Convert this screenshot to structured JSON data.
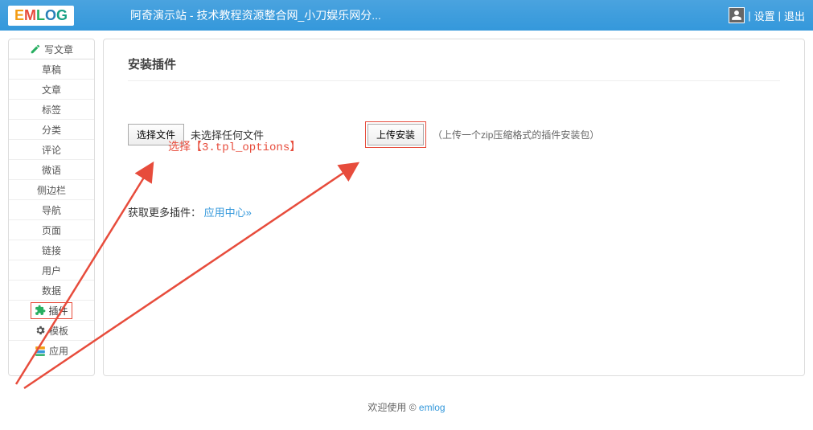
{
  "topbar": {
    "site_title": "阿奇演示站 - 技术教程资源整合网_小刀娱乐网分...",
    "settings": "设置",
    "logout": "退出"
  },
  "logo": {
    "E": "E",
    "M": "M",
    "L": "L",
    "O": "O",
    "G": "G"
  },
  "sidebar": {
    "items": [
      {
        "label": "写文章",
        "icon": "pencil"
      },
      {
        "label": "草稿"
      },
      {
        "label": "文章"
      },
      {
        "label": "标签"
      },
      {
        "label": "分类"
      },
      {
        "label": "评论"
      },
      {
        "label": "微语"
      },
      {
        "label": "侧边栏"
      },
      {
        "label": "导航"
      },
      {
        "label": "页面"
      },
      {
        "label": "链接"
      },
      {
        "label": "用户"
      },
      {
        "label": "数据"
      },
      {
        "label": "插件",
        "icon": "plugin",
        "active": true
      },
      {
        "label": "模板",
        "icon": "gear"
      },
      {
        "label": "应用",
        "icon": "apps"
      }
    ]
  },
  "main": {
    "heading": "安装插件",
    "choose_file": "选择文件",
    "no_file": "未选择任何文件",
    "upload_install": "上传安装",
    "hint": "（上传一个zip压缩格式的插件安装包）",
    "more_prefix": "获取更多插件：",
    "more_link": "应用中心»"
  },
  "annotation": {
    "text": "选择【3.tpl_options】"
  },
  "footer": {
    "text": "欢迎使用 © ",
    "link": "emlog"
  }
}
